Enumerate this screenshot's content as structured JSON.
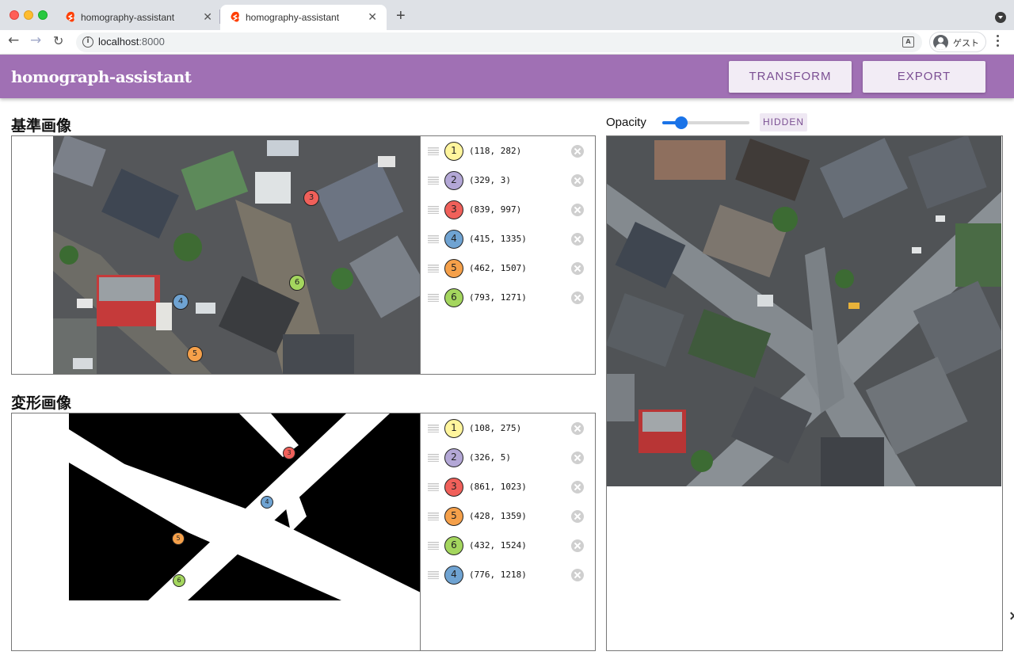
{
  "browser": {
    "tabs": [
      {
        "title": "homography-assistant",
        "active": false
      },
      {
        "title": "homography-assistant",
        "active": true
      }
    ],
    "url_host": "localhost",
    "url_port": ":8000",
    "profile_name": "ゲスト",
    "icons": [
      "back-arrow-icon",
      "forward-arrow-icon",
      "reload-icon",
      "info-icon",
      "translate-icon",
      "profile-icon",
      "kebab-menu-icon",
      "new-tab-icon",
      "svelte-favicon-icon"
    ]
  },
  "header": {
    "title": "homograph-assistant",
    "transform_label": "TRANSFORM",
    "export_label": "EXPORT",
    "color": "#a070b4"
  },
  "reference": {
    "title": "基準画像",
    "points": [
      {
        "id": "1",
        "coords": "(118, 282)",
        "color": "#fff59d"
      },
      {
        "id": "2",
        "coords": "(329, 3)",
        "color": "#b3a7d6"
      },
      {
        "id": "3",
        "coords": "(839, 997)",
        "color": "#f0605a"
      },
      {
        "id": "4",
        "coords": "(415, 1335)",
        "color": "#6fa3d2"
      },
      {
        "id": "5",
        "coords": "(462, 1507)",
        "color": "#f5a04a"
      },
      {
        "id": "6",
        "coords": "(793, 1271)",
        "color": "#a4d65e"
      }
    ]
  },
  "transformed": {
    "title": "変形画像",
    "points": [
      {
        "id": "1",
        "coords": "(108, 275)",
        "color": "#fff59d"
      },
      {
        "id": "2",
        "coords": "(326, 5)",
        "color": "#b3a7d6"
      },
      {
        "id": "3",
        "coords": "(861, 1023)",
        "color": "#f0605a"
      },
      {
        "id": "5",
        "coords": "(428, 1359)",
        "color": "#f5a04a"
      },
      {
        "id": "6",
        "coords": "(432, 1524)",
        "color": "#a4d65e"
      },
      {
        "id": "4",
        "coords": "(776, 1218)",
        "color": "#6fa3d2"
      }
    ]
  },
  "overlay": {
    "opacity_label": "Opacity",
    "opacity_value": 0.22,
    "hidden_label": "HIDDEN"
  }
}
